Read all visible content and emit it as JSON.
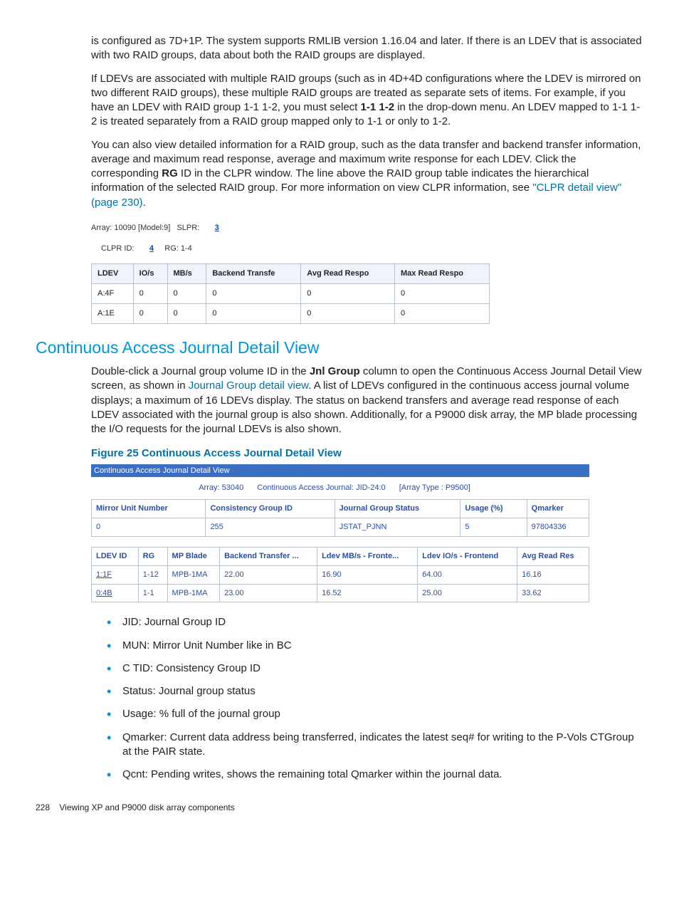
{
  "para1_a": "is configured as 7D+1P. The system supports RMLIB version 1.16.04 and later. If there is an LDEV that is associated with two RAID groups, data about both the RAID groups are displayed.",
  "para2_a": "If LDEVs are associated with multiple RAID groups (such as in 4D+4D configurations where the LDEV is mirrored on two different RAID groups), these multiple RAID groups are treated as separate sets of items. For example, if you have an LDEV with RAID group 1-1 1-2, you must select ",
  "para2_bold": "1-1 1-2",
  "para2_b": " in the drop-down menu. An LDEV mapped to 1-1 1-2 is treated separately from a RAID group mapped only to 1-1 or only to 1-2.",
  "para3_a": "You can also view detailed information for a RAID group, such as the data transfer and backend transfer information, average and maximum read response, average and maximum write response for each LDEV. Click the corresponding ",
  "para3_bold": "RG",
  "para3_b": " ID in the CLPR window. The line above the RAID group table indicates the hierarchical information of the selected RAID group. For more information on view CLPR information, see ",
  "para3_link": "\"CLPR detail view\" (page 230)",
  "para3_c": ".",
  "embed1": {
    "array_label": "Array: 10090 [Model:9]",
    "slpr_label": "SLPR:",
    "slpr_val": "3",
    "clpr_label": "CLPR ID:",
    "clpr_val": "4",
    "rg_label": "RG: 1-4",
    "headers": [
      "LDEV",
      "IO/s",
      "MB/s",
      "Backend Transfe",
      "Avg Read Respo",
      "Max Read Respo"
    ],
    "rows": [
      [
        "A:4F",
        "0",
        "0",
        "0",
        "0",
        "0"
      ],
      [
        "A:1E",
        "0",
        "0",
        "0",
        "0",
        "0"
      ]
    ]
  },
  "section_title": "Continuous Access Journal Detail View",
  "para4_a": "Double-click a Journal group volume ID in the ",
  "para4_bold": "Jnl Group",
  "para4_b": " column to open the Continuous Access Journal Detail View screen, as shown in ",
  "para4_link": "Journal Group detail view",
  "para4_c": ". A list of LDEVs configured in the continuous access journal volume displays; a maximum of 16 LDEVs display. The status on backend transfers and average read response of each LDEV associated with the journal group is also shown. Additionally, for a P9000 disk array, the MP blade processing the I/O requests for the journal LDEVs is also shown.",
  "fig_caption": "Figure 25 Continuous Access Journal Detail View",
  "embed2": {
    "bar_title": "Continuous Access Journal Detail View",
    "info_array": "Array: 53040",
    "info_caj": "Continuous Access Journal: JID-24:0",
    "info_type": "[Array Type : P9500]",
    "summary_headers": [
      "Mirror Unit Number",
      "Consistency Group ID",
      "Journal Group Status",
      "Usage (%)",
      "Qmarker"
    ],
    "summary_row": [
      "0",
      "255",
      "JSTAT_PJNN",
      "5",
      "97804336"
    ],
    "detail_headers": [
      "LDEV ID",
      "RG",
      "MP Blade",
      "Backend Transfer ...",
      "Ldev MB/s - Fronte...",
      "Ldev IO/s - Frontend",
      "Avg Read Res"
    ],
    "detail_rows": [
      [
        "1:1F",
        "1-12",
        "MPB-1MA",
        "22.00",
        "16.90",
        "64.00",
        "16.16"
      ],
      [
        "0:4B",
        "1-1",
        "MPB-1MA",
        "23.00",
        "16.52",
        "25.00",
        "33.62"
      ]
    ]
  },
  "bullets": [
    "JID: Journal Group ID",
    "MUN: Mirror Unit Number like in BC",
    "C TID: Consistency Group ID",
    "Status: Journal group status",
    "Usage: % full of the journal group",
    "Qmarker: Current data address being transferred, indicates the latest seq# for writing to the P-Vols CTGroup at the PAIR state.",
    "Qcnt: Pending writes, shows the remaining total Qmarker within the journal data."
  ],
  "footer_page": "228",
  "footer_text": "Viewing XP and P9000 disk array components"
}
